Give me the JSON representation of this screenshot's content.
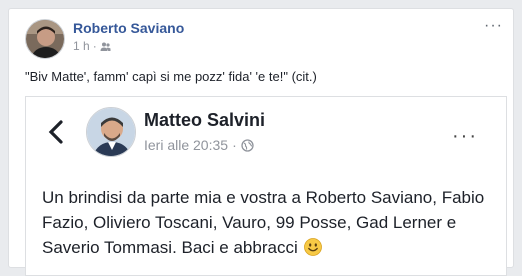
{
  "post": {
    "author": "Roberto Saviano",
    "time": "1 h",
    "separator": "·",
    "privacy_icon": "friends-icon",
    "more_label": "···",
    "caption": "\"Biv Matte', famm' capì si me pozz' fida' 'e te!\" (cit.)"
  },
  "embedded": {
    "back_icon": "chevron-left-icon",
    "author": "Matteo Salvini",
    "time": "Ieri alle 20:35",
    "separator": "·",
    "privacy_icon": "globe-icon",
    "more_label": "···",
    "text": "Un brindisi da parte mia e vostra a Roberto Saviano, Fabio Fazio, Oliviero Toscani, Vauro, 99 Posse, Gad Lerner e Saverio Tommasi. Baci e abbracci",
    "emoji": "smiley-emoji"
  },
  "colors": {
    "link": "#365899",
    "muted": "#90949c",
    "text": "#1d2129",
    "background": "#e9ebee"
  }
}
